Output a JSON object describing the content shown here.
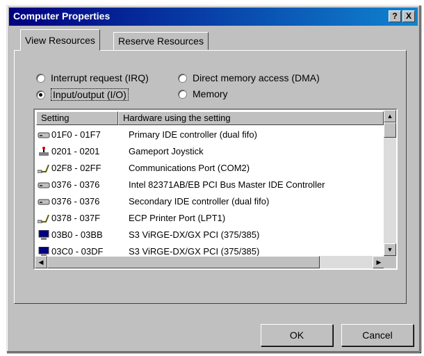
{
  "window": {
    "title": "Computer Properties",
    "help_button": "?",
    "close_button": "X"
  },
  "tabs": [
    {
      "label": "View Resources",
      "active": true
    },
    {
      "label": "Reserve Resources",
      "active": false
    }
  ],
  "options": [
    {
      "label": "Interrupt request (IRQ)",
      "selected": false
    },
    {
      "label": "Input/output (I/O)",
      "selected": true
    },
    {
      "label": "Direct memory access (DMA)",
      "selected": false
    },
    {
      "label": "Memory",
      "selected": false
    }
  ],
  "table": {
    "headers": [
      "Setting",
      "Hardware using the setting"
    ],
    "rows": [
      {
        "icon": "hard-disk-icon",
        "setting": "01F0 - 01F7",
        "hardware": "Primary IDE controller (dual fifo)"
      },
      {
        "icon": "joystick-icon",
        "setting": "0201 - 0201",
        "hardware": "Gameport Joystick"
      },
      {
        "icon": "port-icon",
        "setting": "02F8 - 02FF",
        "hardware": "Communications Port (COM2)"
      },
      {
        "icon": "hard-disk-icon",
        "setting": "0376 - 0376",
        "hardware": "Intel 82371AB/EB PCI Bus Master IDE Controller"
      },
      {
        "icon": "hard-disk-icon",
        "setting": "0376 - 0376",
        "hardware": "Secondary IDE controller (dual fifo)"
      },
      {
        "icon": "port-icon",
        "setting": "0378 - 037F",
        "hardware": "ECP Printer Port (LPT1)"
      },
      {
        "icon": "monitor-icon",
        "setting": "03B0 - 03BB",
        "hardware": "S3 ViRGE-DX/GX PCI (375/385)"
      },
      {
        "icon": "monitor-icon",
        "setting": "03C0 - 03DF",
        "hardware": "S3 ViRGE-DX/GX PCI (375/385)"
      }
    ]
  },
  "buttons": {
    "ok": "OK",
    "cancel": "Cancel"
  },
  "colors": {
    "titlebar_start": "#000080",
    "titlebar_end": "#1084d0",
    "face": "#c0c0c0"
  }
}
